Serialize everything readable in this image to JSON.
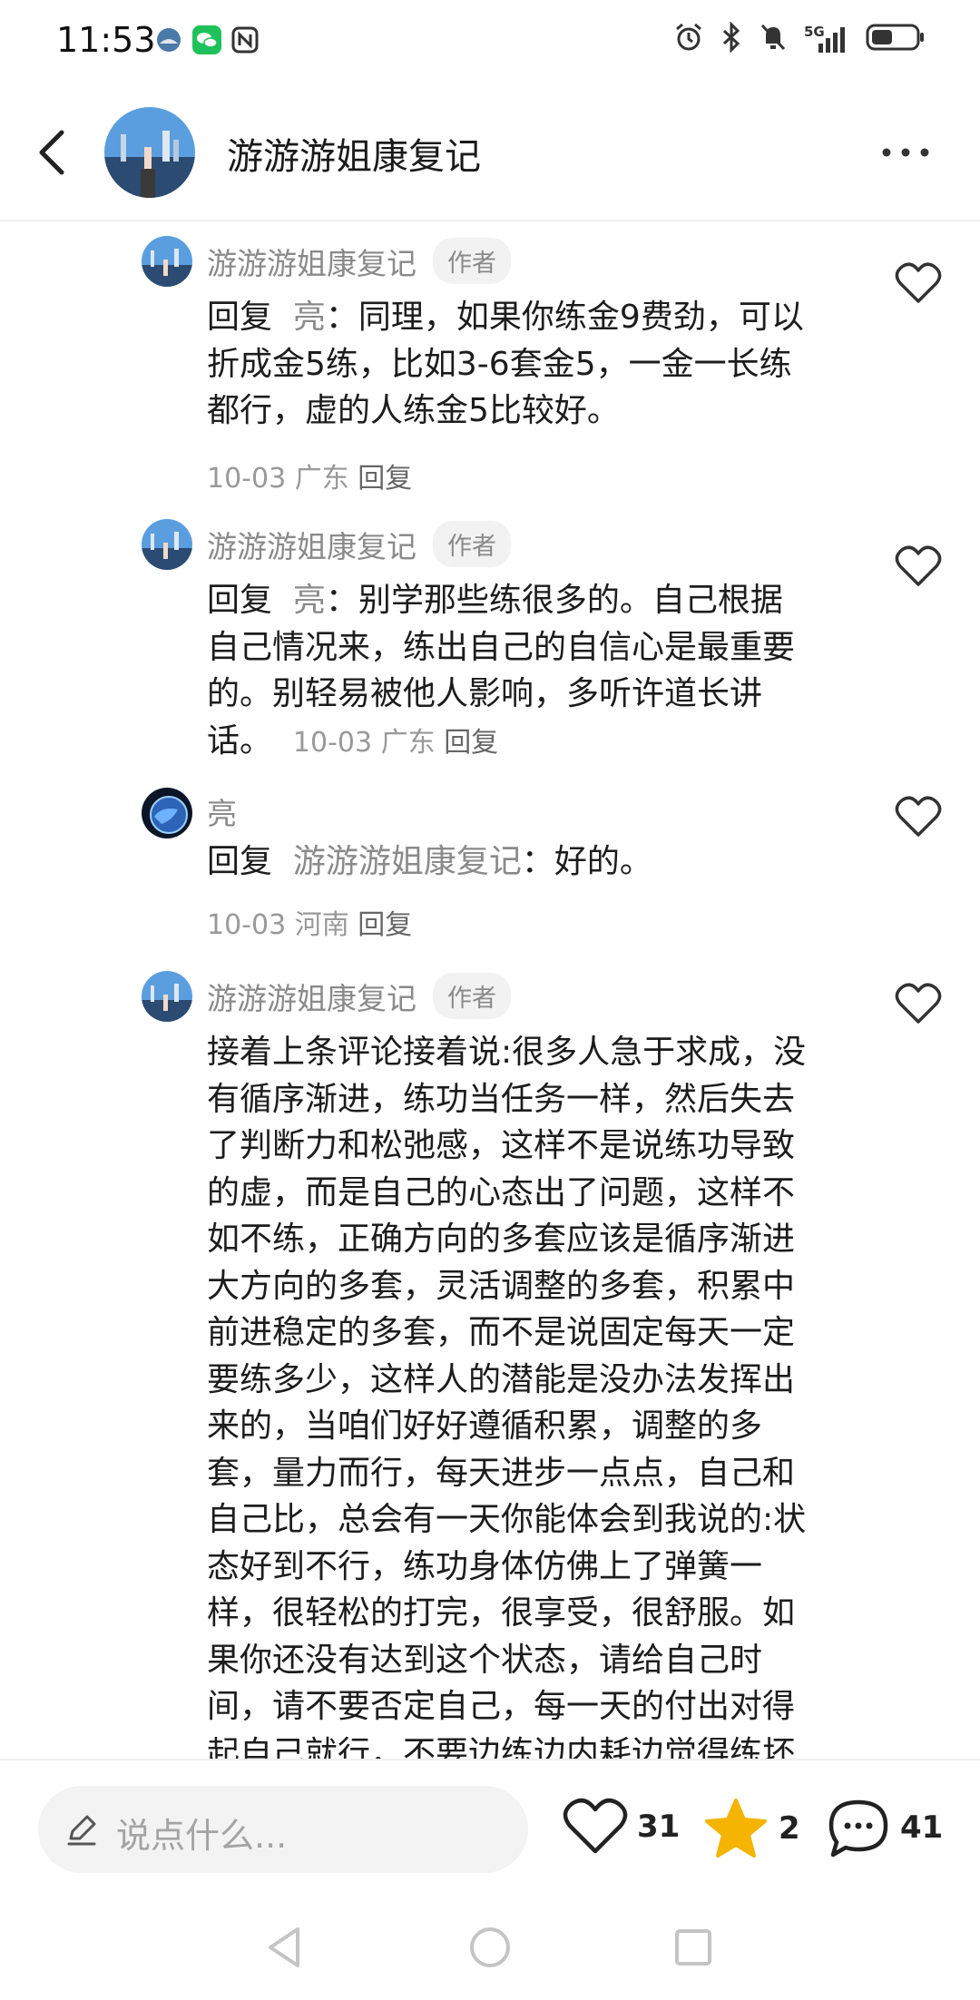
{
  "status_bar": {
    "time": "11:53",
    "left_icons": [
      "app-notification-icon",
      "wechat-icon",
      "nfc-icon"
    ],
    "right_icons": [
      "alarm-icon",
      "bluetooth-icon",
      "mute-icon",
      "signal-5g-icon",
      "battery-icon"
    ],
    "network_label": "5G"
  },
  "header": {
    "title": "游游游姐康复记",
    "back_icon": "chevron-left-icon",
    "more_icon": "more-dots-icon"
  },
  "comments": [
    {
      "name": "游游游姐康复记",
      "badge": "作者",
      "reply_keyword": "回复",
      "reply_target": "亮",
      "body_lines": [
        "：同理，如果你练金9费劲，可以",
        "折成金5练，比如3-6套金5，一金一长练",
        "都行，虚的人练金5比较好。"
      ],
      "meta_date": "10-03",
      "meta_location": "广东",
      "meta_reply": "回复"
    },
    {
      "name": "游游游姐康复记",
      "badge": "作者",
      "reply_keyword": "回复",
      "reply_target": "亮",
      "body_lines": [
        "：别学那些练很多的。自己根据",
        "自己情况来，练出自己的自信心是最重要",
        "的。别轻易被他人影响，多听许道长讲",
        "话。"
      ],
      "meta_date": "10-03",
      "meta_location": "广东",
      "meta_reply": "回复"
    },
    {
      "name": "亮",
      "reply_keyword": "回复",
      "reply_target": "游游游姐康复记",
      "body_lines": [
        "：好的。"
      ],
      "meta_date": "10-03",
      "meta_location": "河南",
      "meta_reply": "回复"
    },
    {
      "name": "游游游姐康复记",
      "badge": "作者",
      "body_lines": [
        "接着上条评论接着说:很多人急于求成，没",
        "有循序渐进，练功当任务一样，然后失去",
        "了判断力和松弛感，这样不是说练功导致",
        "的虚，而是自己的心态出了问题，这样不",
        "如不练，正确方向的多套应该是循序渐进",
        "大方向的多套，灵活调整的多套，积累中",
        "前进稳定的多套，而不是说固定每天一定",
        "要练多少，这样人的潜能是没办法发挥出",
        "来的，当咱们好好遵循积累，调整的多",
        "套，量力而行，每天进步一点点，自己和",
        "自己比，总会有一天你能体会到我说的:状",
        "态好到不行，练功身体仿佛上了弹簧一",
        "样，很轻松的打完，很享受，很舒服。如",
        "果你还没有达到这个状态，请给自己时",
        "间，请不要否定自己，每一天的付出对得",
        "起自己就行，不要边练边内耗边觉得练坏"
      ]
    }
  ],
  "bottom_bar": {
    "input_placeholder": "说点什么...",
    "likes": "31",
    "favorites": "2",
    "comments": "41",
    "star_color": "#F5B400"
  },
  "nav_bar": {
    "icons": [
      "nav-back-icon",
      "nav-home-icon",
      "nav-recents-icon"
    ]
  }
}
